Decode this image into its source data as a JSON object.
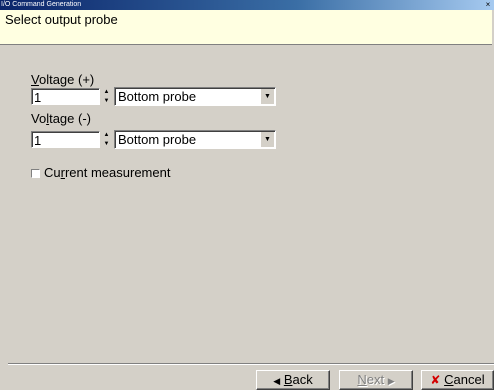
{
  "window": {
    "title": "I/O Command Generation",
    "close_glyph": "×"
  },
  "header": {
    "title": "Select output probe"
  },
  "voltage_plus": {
    "label_mnemonic": "V",
    "label_rest": "oltage (+)",
    "value": "1",
    "probe": "Bottom probe"
  },
  "voltage_minus": {
    "label_pre": "Vo",
    "label_mnemonic": "l",
    "label_rest": "tage (-)",
    "value": "1",
    "probe": "Bottom probe"
  },
  "current_measurement": {
    "label_pre": "Cu",
    "label_mnemonic": "r",
    "label_rest": "rent measurement",
    "checked": false
  },
  "footer": {
    "back_arrow": "◀",
    "back_mnemonic": "B",
    "back_rest": "ack",
    "next_mnemonic": "N",
    "next_rest": "ext",
    "next_arrow": "▶",
    "cancel_icon": "✘",
    "cancel_mnemonic": "C",
    "cancel_rest": "ancel"
  },
  "icons": {
    "spin_up": "▲",
    "spin_down": "▼",
    "dropdown": "▼"
  }
}
